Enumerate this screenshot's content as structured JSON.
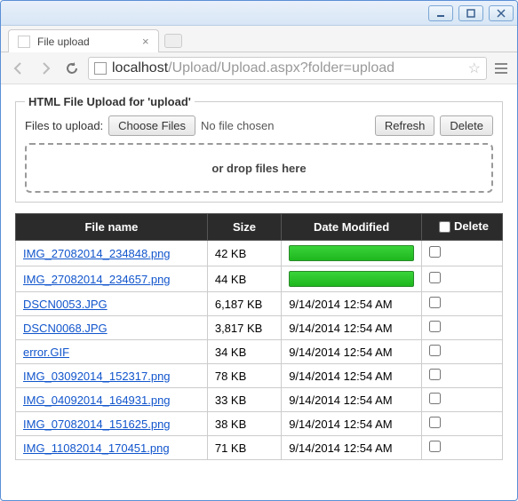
{
  "window": {
    "tab_title": "File upload",
    "url_pre": "localhost",
    "url_post": "/Upload/Upload.aspx?folder=upload"
  },
  "fieldset": {
    "legend": "HTML File Upload for 'upload'",
    "files_to_upload_label": "Files to upload:",
    "choose_files_label": "Choose Files",
    "no_file_chosen": "No file chosen",
    "refresh_label": "Refresh",
    "delete_label": "Delete",
    "drop_hint": "or drop files here"
  },
  "table": {
    "headers": {
      "filename": "File name",
      "size": "Size",
      "date": "Date Modified",
      "delete": "Delete"
    },
    "rows": [
      {
        "name": "IMG_27082014_234848.png",
        "size": "42 KB",
        "date_is_progress": true,
        "date": ""
      },
      {
        "name": "IMG_27082014_234657.png",
        "size": "44 KB",
        "date_is_progress": true,
        "date": ""
      },
      {
        "name": "DSCN0053.JPG",
        "size": "6,187 KB",
        "date_is_progress": false,
        "date": "9/14/2014 12:54 AM"
      },
      {
        "name": "DSCN0068.JPG",
        "size": "3,817 KB",
        "date_is_progress": false,
        "date": "9/14/2014 12:54 AM"
      },
      {
        "name": "error.GIF",
        "size": "34 KB",
        "date_is_progress": false,
        "date": "9/14/2014 12:54 AM"
      },
      {
        "name": "IMG_03092014_152317.png",
        "size": "78 KB",
        "date_is_progress": false,
        "date": "9/14/2014 12:54 AM"
      },
      {
        "name": "IMG_04092014_164931.png",
        "size": "33 KB",
        "date_is_progress": false,
        "date": "9/14/2014 12:54 AM"
      },
      {
        "name": "IMG_07082014_151625.png",
        "size": "38 KB",
        "date_is_progress": false,
        "date": "9/14/2014 12:54 AM"
      },
      {
        "name": "IMG_11082014_170451.png",
        "size": "71 KB",
        "date_is_progress": false,
        "date": "9/14/2014 12:54 AM"
      }
    ]
  }
}
